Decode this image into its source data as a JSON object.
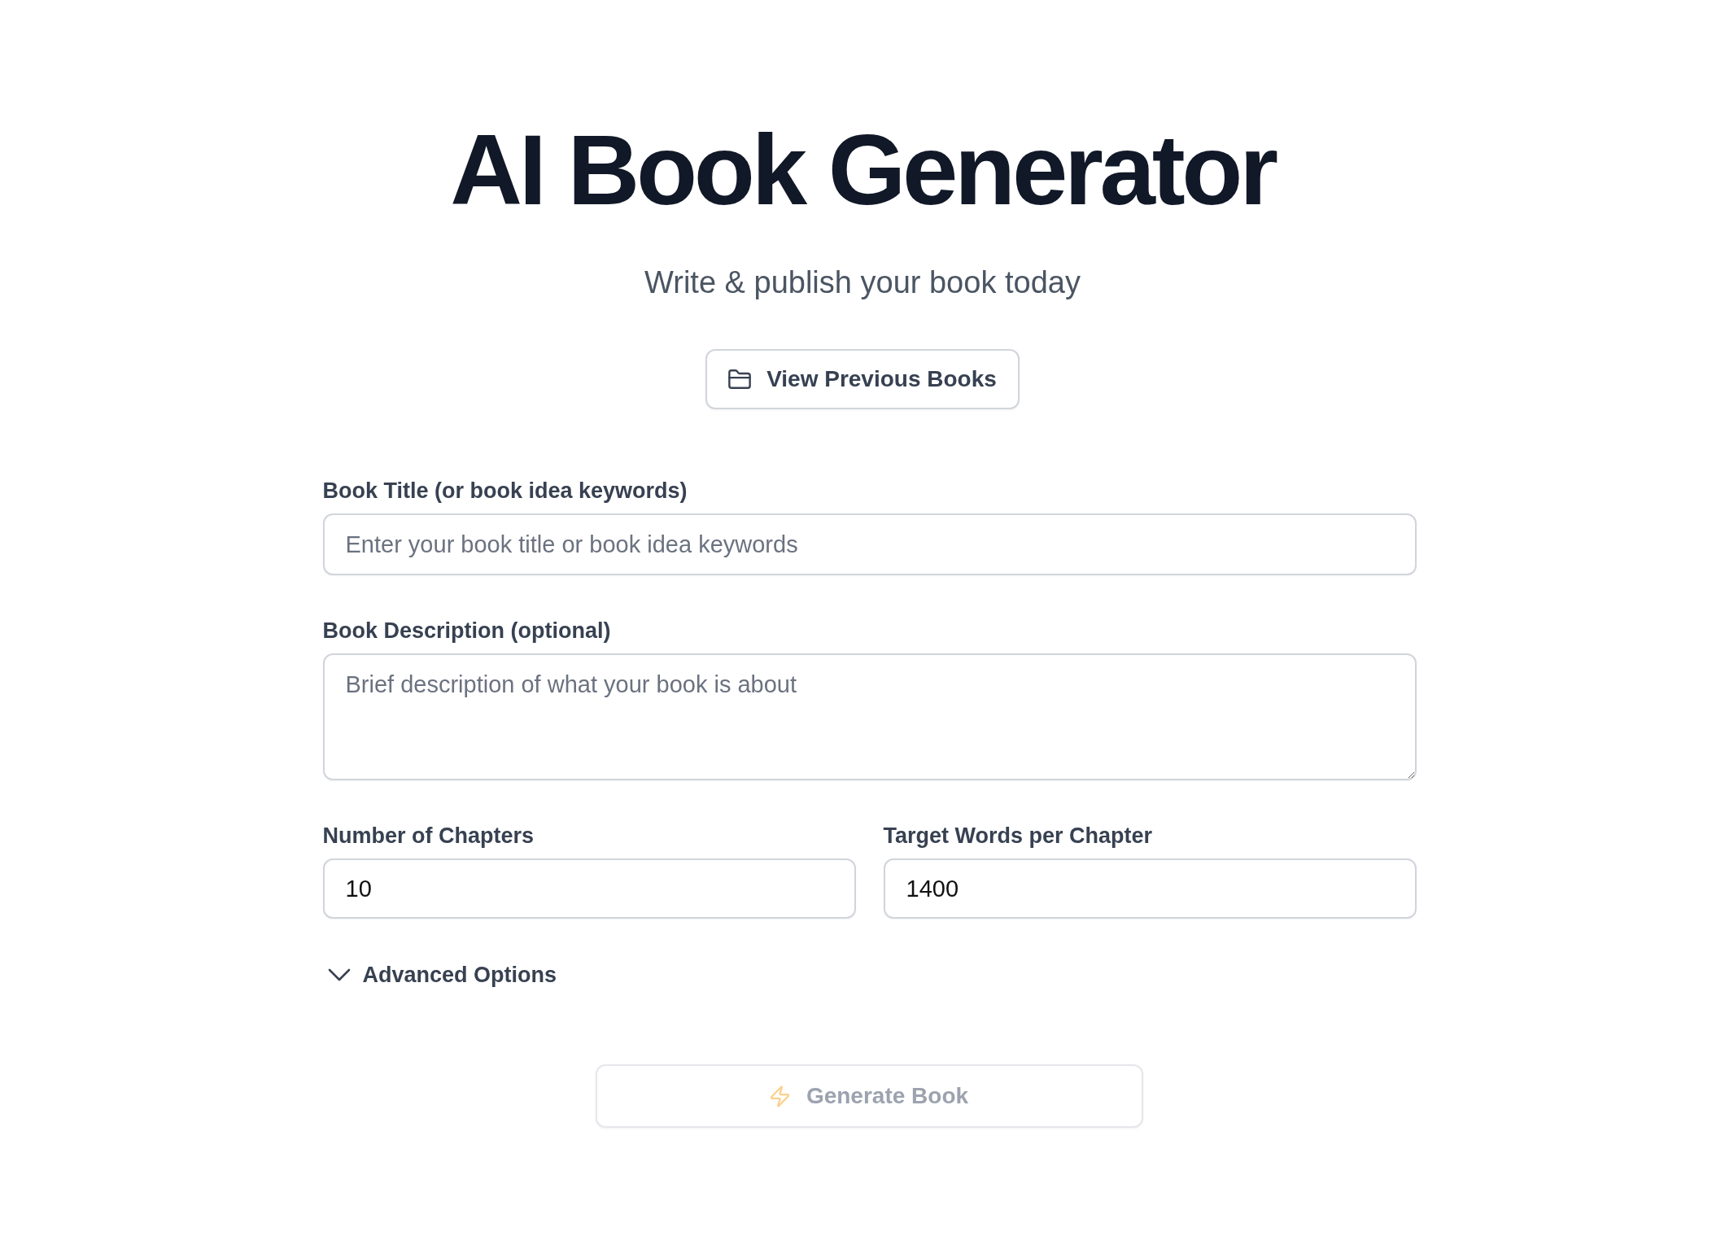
{
  "header": {
    "title": "AI Book Generator",
    "subtitle": "Write & publish your book today"
  },
  "previous_books_button": {
    "label": "View Previous Books"
  },
  "form": {
    "fields": [
      {
        "kind": "text",
        "label": "Book Title (or book idea keywords)",
        "placeholder": "Enter your book title or book idea keywords"
      },
      {
        "kind": "textarea",
        "label": "Book Description (optional)",
        "placeholder": "Brief description of what your book is about"
      }
    ],
    "row_fields": [
      {
        "kind": "number",
        "label": "Number of Chapters",
        "value": "10"
      },
      {
        "kind": "number",
        "label": "Target Words per Chapter",
        "value": "1400"
      }
    ],
    "advanced_options": {
      "label": "Advanced Options",
      "expanded": false
    },
    "generate_button": {
      "label": "Generate Book",
      "disabled": true
    }
  }
}
